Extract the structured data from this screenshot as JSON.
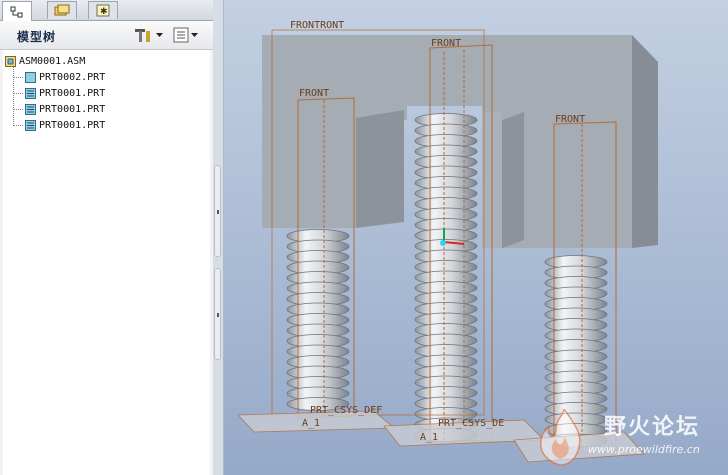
{
  "left_panel": {
    "tabs": [
      {
        "name": "model-tree-tab-icon",
        "active": true
      },
      {
        "name": "folder-browser-tab-icon",
        "active": false
      },
      {
        "name": "favorites-tab-icon",
        "active": false
      }
    ],
    "title": "模型树",
    "settings_button": "tree-settings-icon",
    "show_button": "tree-show-icon",
    "tree": {
      "root": "ASM0001.ASM",
      "items": [
        {
          "label": "PRT0002.PRT",
          "icon": "part-icon"
        },
        {
          "label": "PRT0001.PRT",
          "icon": "part-spring-icon"
        },
        {
          "label": "PRT0001.PRT",
          "icon": "part-spring-icon"
        },
        {
          "label": "PRT0001.PRT",
          "icon": "part-spring-icon"
        }
      ]
    }
  },
  "viewport": {
    "datum_labels": {
      "frontront": "FRONTRONT",
      "front_center": "FRONT",
      "front_left": "FRONT",
      "front_right": "FRONT",
      "csys_left": "PRT_CSYS_DEF",
      "csys_center": "PRT_CSYS_DE",
      "axis_left": "A_1",
      "axis_center": "A_1"
    },
    "colors": {
      "background_top": "#c3d0e2",
      "background_bottom": "#95a9c8",
      "block": "#a7aeb6",
      "spring": "#d6d9de",
      "datum": "#b46a34"
    }
  },
  "watermark": {
    "title": "野火论坛",
    "url": "www.proewildfire.cn"
  }
}
